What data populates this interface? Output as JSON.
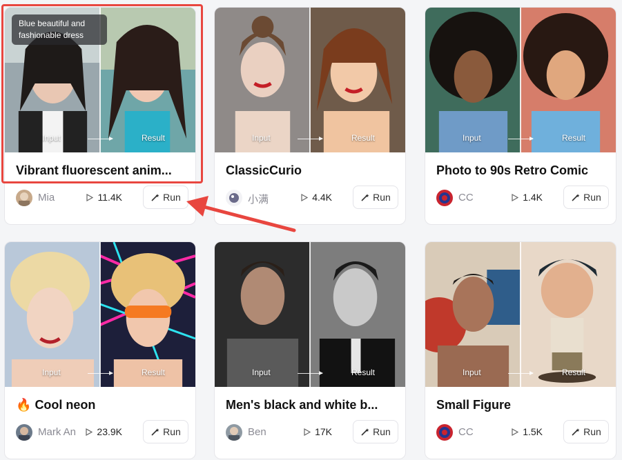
{
  "cards": [
    {
      "title": "Vibrant fluorescent anim...",
      "author": "Mia",
      "plays": "11.4K",
      "run_label": "Run",
      "input_label": "Input",
      "result_label": "Result",
      "tag": "Blue beautiful and fashionable dress"
    },
    {
      "title": "ClassicCurio",
      "author": "小满",
      "plays": "4.4K",
      "run_label": "Run",
      "input_label": "Input",
      "result_label": "Result"
    },
    {
      "title": "Photo to 90s Retro Comic",
      "author": "CC",
      "plays": "1.4K",
      "run_label": "Run",
      "input_label": "Input",
      "result_label": "Result"
    },
    {
      "title": "Cool neon",
      "title_icon": "🔥",
      "author": "Mark An",
      "plays": "23.9K",
      "run_label": "Run",
      "input_label": "Input",
      "result_label": "Result"
    },
    {
      "title": "Men's black and white b...",
      "author": "Ben",
      "plays": "17K",
      "run_label": "Run",
      "input_label": "Input",
      "result_label": "Result"
    },
    {
      "title": "Small Figure",
      "author": "CC",
      "plays": "1.5K",
      "run_label": "Run",
      "input_label": "Input",
      "result_label": "Result"
    }
  ],
  "annotation": {
    "highlight_color": "#e8463f"
  },
  "icons": {
    "play": "play-icon",
    "run": "magic-wand-icon",
    "flame": "flame-icon"
  }
}
